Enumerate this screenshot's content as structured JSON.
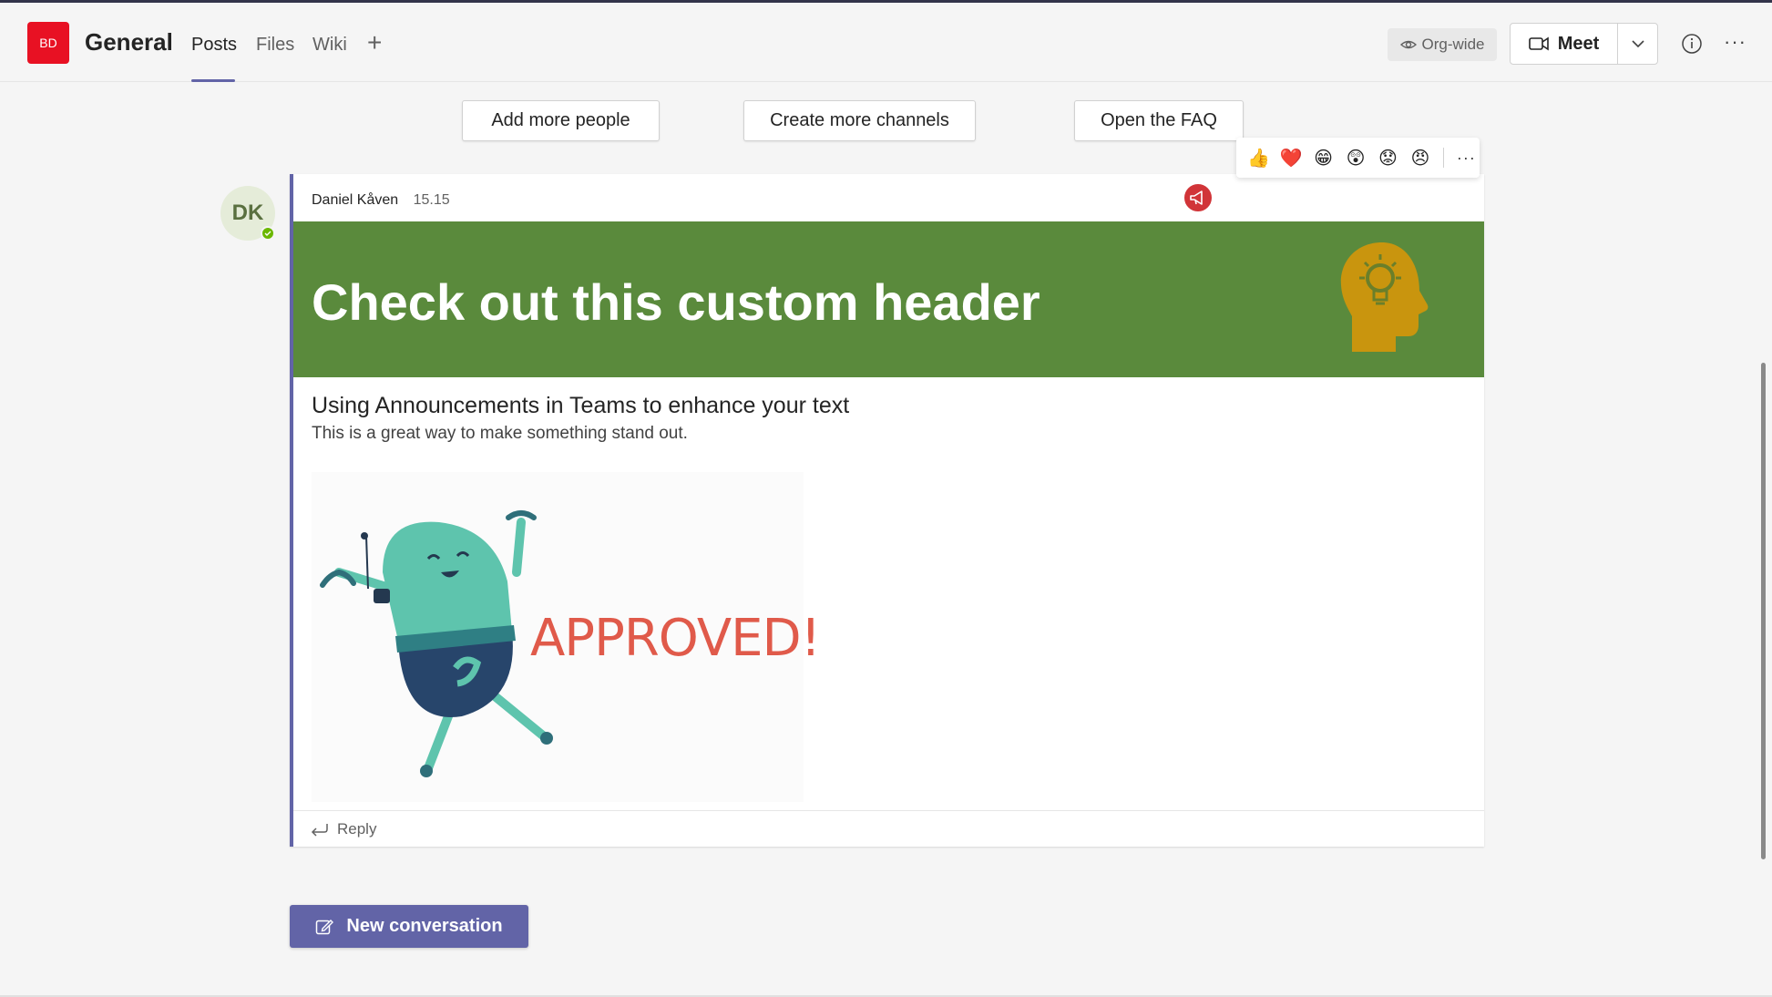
{
  "header": {
    "team_initials": "BD",
    "channel_name": "General",
    "tabs": [
      {
        "label": "Posts",
        "active": true
      },
      {
        "label": "Files",
        "active": false
      },
      {
        "label": "Wiki",
        "active": false
      }
    ],
    "add_tab": "+",
    "org_wide": "Org-wide",
    "meet_label": "Meet"
  },
  "actions": [
    {
      "label": "Add more people"
    },
    {
      "label": "Create more channels"
    },
    {
      "label": "Open the FAQ"
    }
  ],
  "reactions": {
    "emojis": [
      "👍",
      "❤️",
      "😁",
      "😲",
      "😟",
      "😠"
    ],
    "more": "···"
  },
  "post": {
    "author_initials": "DK",
    "author": "Daniel Kåven",
    "time": "15.15",
    "banner_title": "Check out this custom header",
    "subject": "Using Announcements in Teams to enhance your text",
    "body": "This is a great way to make something stand out.",
    "image_text": "APPROVED!",
    "reply_label": "Reply"
  },
  "composer": {
    "new_conversation": "New conversation"
  },
  "colors": {
    "brand": "#6264a7",
    "banner": "#5a8a3c",
    "team_avatar": "#e81123",
    "announcement": "#d13438"
  }
}
